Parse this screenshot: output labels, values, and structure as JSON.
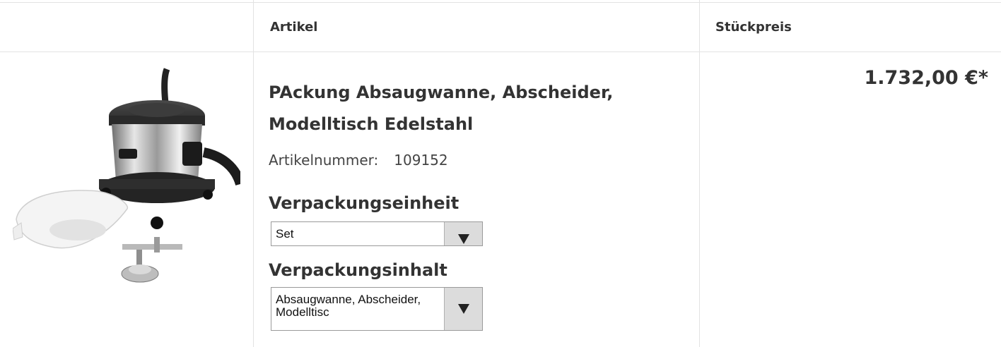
{
  "header": {
    "article_col": "Artikel",
    "price_col": "Stückpreis"
  },
  "product": {
    "title": "PAckung Absaugwanne, Abscheider, Modelltisch Edelstahl",
    "article_number_label": "Artikelnummer:",
    "article_number": "109152",
    "price": "1.732,00 €*",
    "image_icon": "vacuum-extractor-with-tray-and-model-table"
  },
  "options": {
    "packaging_unit_label": "Verpackungseinheit",
    "packaging_unit_value": "Set",
    "packaging_content_label": "Verpackungsinhalt",
    "packaging_content_value": "Absaugwanne, Abscheider, Modelltisc"
  },
  "colors": {
    "text": "#333333",
    "border": "#e3e3e3",
    "select_arrow_bg": "#dcdcdc"
  }
}
